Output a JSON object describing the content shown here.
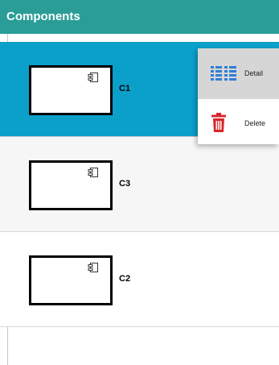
{
  "panel": {
    "title": "Components"
  },
  "components": [
    {
      "label": "C1",
      "selected": true
    },
    {
      "label": "C3",
      "selected": false
    },
    {
      "label": "C2",
      "selected": false
    }
  ],
  "context_menu": {
    "items": [
      {
        "label": "Detail",
        "icon": "list-detail-icon"
      },
      {
        "label": "Delete",
        "icon": "trash-icon"
      }
    ]
  },
  "colors": {
    "header": "#2a9d97",
    "selected_row": "#0aa0c9",
    "detail_icon": "#2f7fd6",
    "delete_icon": "#d9262c"
  }
}
